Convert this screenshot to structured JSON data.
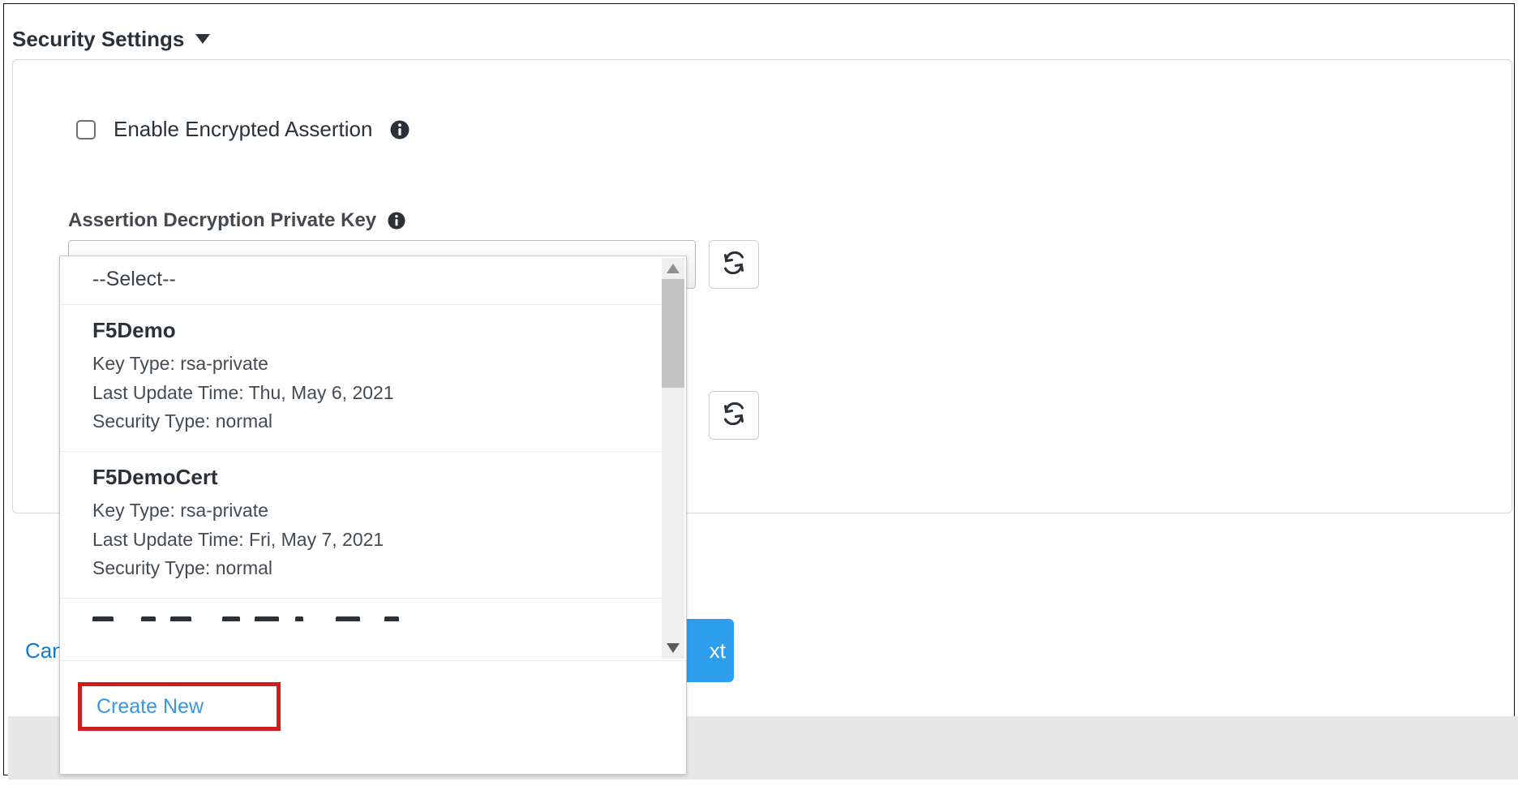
{
  "section": {
    "title": "Security Settings"
  },
  "checkbox": {
    "label": "Enable Encrypted Assertion"
  },
  "field": {
    "label": "Assertion Decryption Private Key"
  },
  "select": {
    "value": "Create New"
  },
  "dropdown": {
    "placeholder": "--Select--",
    "items": [
      {
        "name": "F5Demo",
        "key_type": "Key Type: rsa-private",
        "updated": "Last Update Time: Thu, May 6, 2021",
        "security": "Security Type: normal"
      },
      {
        "name": "F5DemoCert",
        "key_type": "Key Type: rsa-private",
        "updated": "Last Update Time: Fri, May 7, 2021",
        "security": "Security Type: normal"
      }
    ],
    "create_new_label": "Create New"
  },
  "buttons": {
    "cancel": "Can",
    "next": "xt"
  },
  "colors": {
    "link": "#0e7ad1",
    "highlight_border": "#cf1c1c",
    "primary_button": "#2e9fee"
  }
}
